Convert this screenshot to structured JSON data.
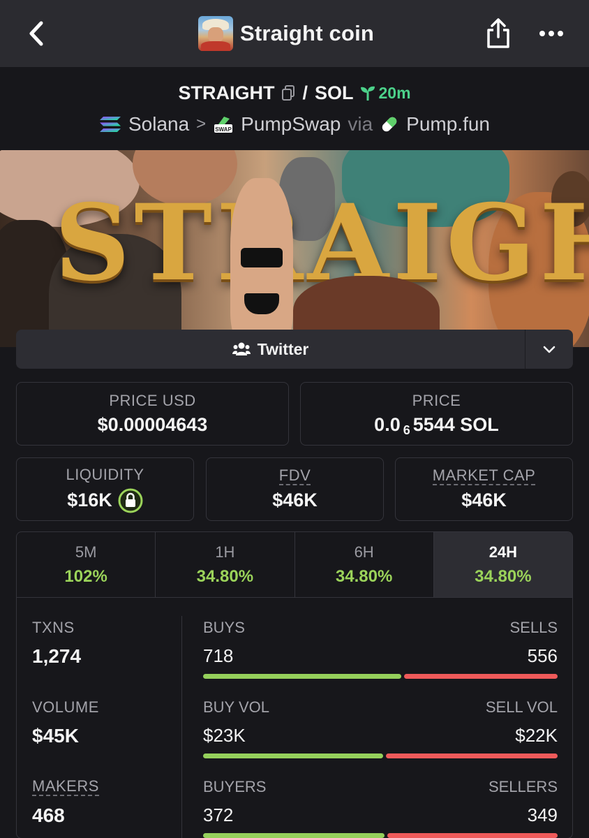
{
  "header": {
    "title": "Straight coin",
    "back_icon": "chevron-left-icon",
    "share_icon": "share-icon",
    "more_icon": "more-horizontal-icon"
  },
  "pair": {
    "base": "STRAIGHT",
    "separator": "/",
    "quote": "SOL",
    "age": "20m",
    "age_color": "#4cd18a"
  },
  "chain": {
    "network": "Solana",
    "dex": "PumpSwap",
    "via": "via",
    "launchpad": "Pump.fun"
  },
  "banner": {
    "text": "STRAIGHT"
  },
  "socials": {
    "twitter_label": "Twitter"
  },
  "price": {
    "usd_label": "PRICE USD",
    "usd_value": "$0.00004643",
    "native_label": "PRICE",
    "native_prefix": "0.0",
    "native_zeros": "6",
    "native_digits": "5544 SOL"
  },
  "metrics": {
    "liquidity_label": "LIQUIDITY",
    "liquidity_value": "$16K",
    "fdv_label": "FDV",
    "fdv_value": "$46K",
    "mcap_label": "MARKET CAP",
    "mcap_value": "$46K"
  },
  "timeframes": [
    {
      "label": "5M",
      "change": "102%"
    },
    {
      "label": "1H",
      "change": "34.80%"
    },
    {
      "label": "6H",
      "change": "34.80%"
    },
    {
      "label": "24H",
      "change": "34.80%"
    }
  ],
  "active_timeframe": "24H",
  "stats": {
    "txns_label": "TXNS",
    "txns_value": "1,274",
    "volume_label": "VOLUME",
    "volume_value": "$45K",
    "makers_label": "MAKERS",
    "makers_value": "468",
    "buys_label": "BUYS",
    "buys_value": "718",
    "sells_label": "SELLS",
    "sells_value": "556",
    "buy_vol_label": "BUY VOL",
    "buy_vol_value": "$23K",
    "sell_vol_label": "SELL VOL",
    "sell_vol_value": "$22K",
    "buyers_label": "BUYERS",
    "buyers_value": "372",
    "sellers_label": "SELLERS",
    "sellers_value": "349"
  },
  "bars": {
    "txns_buy_fraction": 0.564,
    "volume_buy_fraction": 0.511,
    "makers_buy_fraction": 0.516
  },
  "colors": {
    "positive": "#9bd35a",
    "buy_bar": "#95d05b",
    "sell_bar": "#ef5a5a"
  }
}
